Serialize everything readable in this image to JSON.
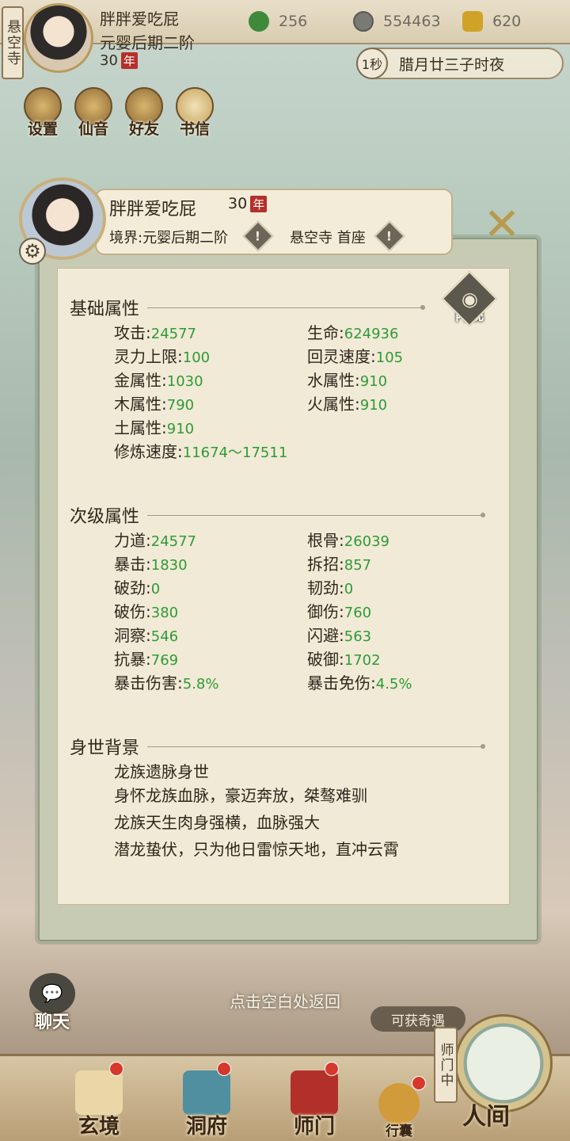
{
  "top": {
    "sect": "悬空寺",
    "name": "胖胖爱吃屁",
    "realm": "元婴后期二阶",
    "age": "30",
    "age_unit": "年",
    "jade": "256",
    "coins": "554463",
    "strength": "620",
    "time_step": "1秒",
    "date": "腊月廿三子时夜"
  },
  "menu": {
    "settings": "设置",
    "music": "仙音",
    "friends": "好友",
    "mail": "书信"
  },
  "panel": {
    "name": "胖胖爱吃屁",
    "age": "30",
    "age_unit": "年",
    "realm": "境界:元婴后期二阶",
    "sect": "悬空寺 首座",
    "inner_view": "内视"
  },
  "basic": {
    "title": "基础属性",
    "left": [
      {
        "k": "攻击",
        "v": "24577"
      },
      {
        "k": "灵力上限",
        "v": "100"
      },
      {
        "k": "金属性",
        "v": "1030"
      },
      {
        "k": "木属性",
        "v": "790"
      },
      {
        "k": "土属性",
        "v": "910"
      },
      {
        "k": "修炼速度",
        "v": "11674～17511"
      }
    ],
    "right": [
      {
        "k": "生命",
        "v": "624936"
      },
      {
        "k": "回灵速度",
        "v": "105"
      },
      {
        "k": "水属性",
        "v": "910"
      },
      {
        "k": "火属性",
        "v": "910"
      }
    ]
  },
  "secondary": {
    "title": "次级属性",
    "left": [
      {
        "k": "力道",
        "v": "24577"
      },
      {
        "k": "暴击",
        "v": "1830"
      },
      {
        "k": "破劲",
        "v": "0"
      },
      {
        "k": "破伤",
        "v": "380"
      },
      {
        "k": "洞察",
        "v": "546"
      },
      {
        "k": "抗暴",
        "v": "769"
      },
      {
        "k": "暴击伤害",
        "v": "5.8%"
      }
    ],
    "right": [
      {
        "k": "根骨",
        "v": "26039"
      },
      {
        "k": "拆招",
        "v": "857"
      },
      {
        "k": "韧劲",
        "v": "0"
      },
      {
        "k": "御伤",
        "v": "760"
      },
      {
        "k": "闪避",
        "v": "563"
      },
      {
        "k": "破御",
        "v": "1702"
      },
      {
        "k": "暴击免伤",
        "v": "4.5%"
      }
    ]
  },
  "background": {
    "title": "身世背景",
    "lines": [
      "龙族遗脉身世",
      "身怀龙族血脉，豪迈奔放，桀骜难驯",
      "龙族天生肉身强横，血脉强大",
      "潜龙蛰伏，只为他日雷惊天地，直冲云霄"
    ]
  },
  "hint": "点击空白处返回",
  "chat": "聊天",
  "encounter": "可获奇遇",
  "nav": {
    "xuanjing": "玄境",
    "dongfu": "洞府",
    "shimen": "师门",
    "xingnang": "行囊",
    "renjian": "人间",
    "sect_status": "师门中"
  }
}
